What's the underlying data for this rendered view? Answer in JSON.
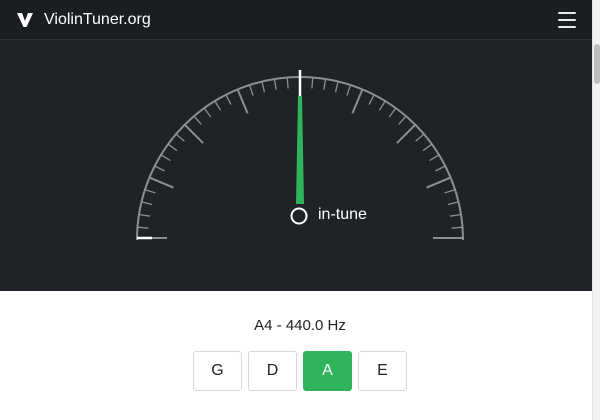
{
  "header": {
    "brand_name": "ViolinTuner.org",
    "logo_icon": "violin-v-logo-icon",
    "menu_icon": "hamburger-menu-icon"
  },
  "gauge": {
    "status": "in-tune",
    "needle_position": 0,
    "colors": {
      "needle": "#2fb45c",
      "ticks": "#8a8f94",
      "background": "#1f2327"
    }
  },
  "tuner": {
    "note_readout": "A4 - 440.0 Hz",
    "strings": [
      {
        "label": "G",
        "active": false
      },
      {
        "label": "D",
        "active": false
      },
      {
        "label": "A",
        "active": true
      },
      {
        "label": "E",
        "active": false
      }
    ],
    "active_color": "#2fb45c"
  }
}
